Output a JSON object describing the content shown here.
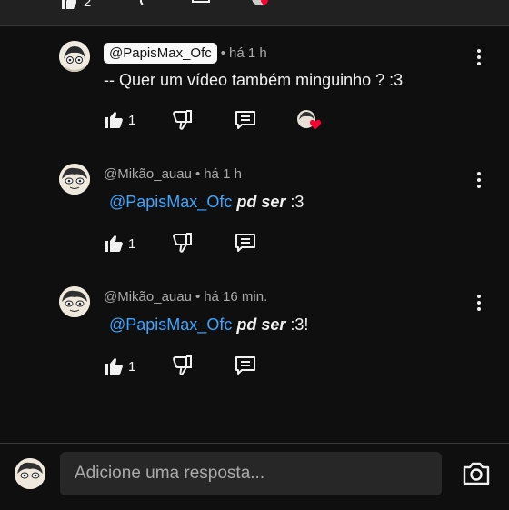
{
  "top": {
    "like_count": "2"
  },
  "comments": [
    {
      "author": "@PapisMax_Ofc",
      "time": "há 1 h",
      "text": "-- Quer um vídeo também minguinho ? :3",
      "likes": "1",
      "creator_hearted": true
    },
    {
      "author": "@Mikão_auau",
      "time": "há 1 h",
      "mention": "@PapisMax_Ofc",
      "bold_text": "pd ser",
      "suffix": " :3",
      "likes": "1"
    },
    {
      "author": "@Mikão_auau",
      "time": "há 16 min.",
      "mention": "@PapisMax_Ofc",
      "bold_text": "pd ser",
      "suffix": " :3!",
      "likes": "1"
    }
  ],
  "separator": "•",
  "reply": {
    "placeholder": "Adicione uma resposta..."
  },
  "colors": {
    "mention": "#3ea6ff",
    "heart": "#ff0033",
    "background": "#0f0f0f"
  }
}
